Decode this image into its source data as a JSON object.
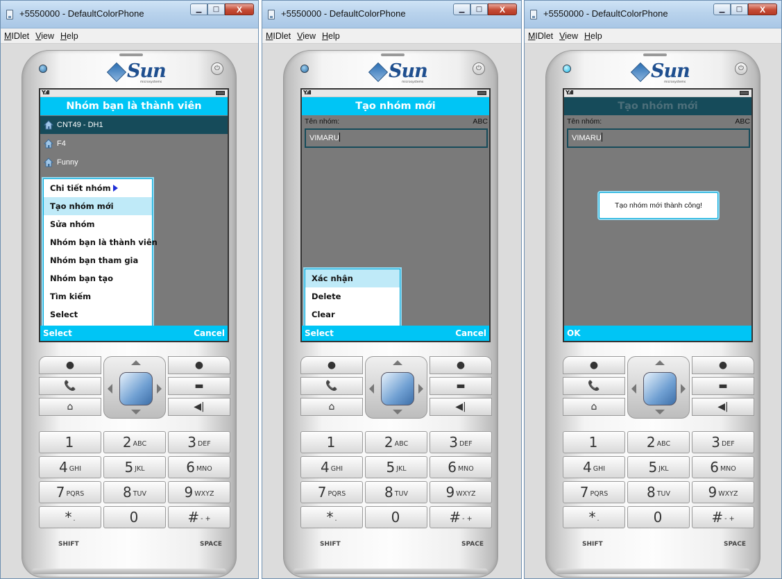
{
  "window": {
    "title": "+5550000 - DefaultColorPhone",
    "menu": [
      "MIDlet",
      "View",
      "Help"
    ]
  },
  "brand": {
    "name": "Sun",
    "sub": "microsystems"
  },
  "colors": {
    "accent": "#00c5f5",
    "selected": "#164b5a",
    "screen_bg": "#7a7a7a"
  },
  "screens": [
    {
      "title": "Nhóm bạn là thành viên",
      "list": [
        "CNT49 - DH1",
        "F4",
        "Funny"
      ],
      "menu": [
        "Chi tiết nhóm",
        "Tạo nhóm mới",
        "Sửa nhóm",
        "Nhóm bạn là thành viên",
        "Nhóm bạn tham gia",
        "Nhóm bạn tạo",
        "Tìm kiếm",
        "Select"
      ],
      "soft_left": "Select",
      "soft_right": "Cancel"
    },
    {
      "title": "Tạo nhóm mới",
      "field_label": "Tên nhóm:",
      "input_mode": "ABC",
      "field_value": "VIMARU",
      "menu": [
        "Xác nhận",
        "Delete",
        "Clear"
      ],
      "soft_left": "Select",
      "soft_right": "Cancel"
    },
    {
      "title": "Tạo nhóm mới",
      "field_label": "Tên nhóm:",
      "input_mode": "ABC",
      "field_value": "VIMARU",
      "alert": "Tạo nhóm mới thành công!",
      "soft_left": "OK"
    }
  ],
  "keypad": {
    "keys": [
      {
        "d": "1",
        "s": ""
      },
      {
        "d": "2",
        "s": "ABC"
      },
      {
        "d": "3",
        "s": "DEF"
      },
      {
        "d": "4",
        "s": "GHI"
      },
      {
        "d": "5",
        "s": "JKL"
      },
      {
        "d": "6",
        "s": "MNO"
      },
      {
        "d": "7",
        "s": "PQRS"
      },
      {
        "d": "8",
        "s": "TUV"
      },
      {
        "d": "9",
        "s": "WXYZ"
      },
      {
        "d": "*",
        "s": "."
      },
      {
        "d": "0",
        "s": ""
      },
      {
        "d": "#",
        "s": "- +"
      }
    ],
    "shift": "SHIFT",
    "space": "SPACE"
  }
}
